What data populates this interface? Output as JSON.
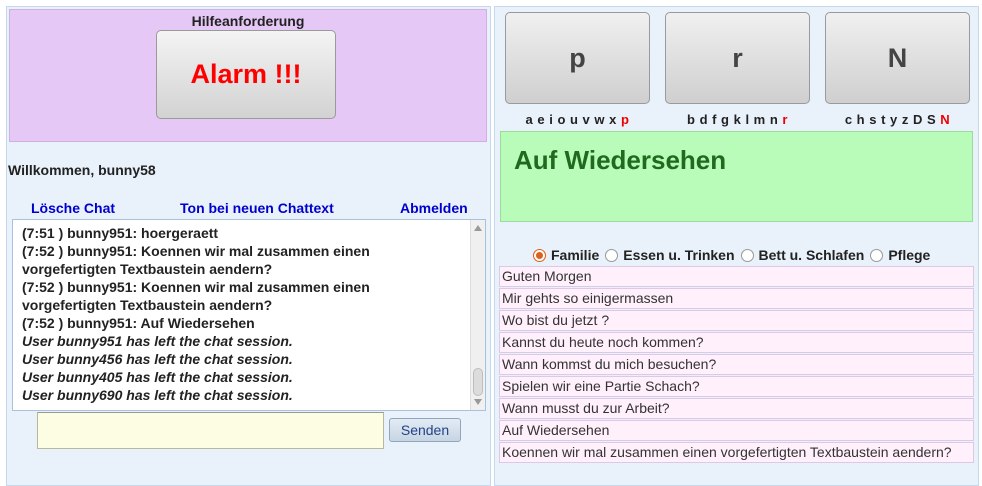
{
  "help": {
    "title": "Hilfeanforderung",
    "alarm_label": "Alarm !!!"
  },
  "welcome": "Willkommen, bunny58",
  "links": {
    "clear_chat": "Lösche Chat",
    "sound": "Ton bei neuen Chattext",
    "logout": "Abmelden"
  },
  "chat": {
    "lines": [
      {
        "text": "(7:51 ) bunny951: hoergeraett",
        "style": "normal"
      },
      {
        "text": "(7:52 ) bunny951: Koennen wir mal zusammen einen",
        "style": "normal"
      },
      {
        "text": "vorgefertigten Textbaustein aendern?",
        "style": "normal"
      },
      {
        "text": "(7:52 ) bunny951: Koennen wir mal zusammen einen",
        "style": "normal"
      },
      {
        "text": "vorgefertigten Textbaustein aendern?",
        "style": "normal"
      },
      {
        "text": "(7:52 ) bunny951: Auf Wiedersehen",
        "style": "normal"
      },
      {
        "text": "User bunny951 has left the chat session.",
        "style": "italic"
      },
      {
        "text": "User bunny456 has left the chat session.",
        "style": "italic"
      },
      {
        "text": "User bunny405 has left the chat session.",
        "style": "italic"
      },
      {
        "text": "User bunny690 has left the chat session.",
        "style": "italic"
      }
    ],
    "input_value": "",
    "send_label": "Senden"
  },
  "letters": [
    {
      "label": "p",
      "chars": "a e i o u v w x",
      "highlight": "p"
    },
    {
      "label": "r",
      "chars": "b d f g k l m n",
      "highlight": "r"
    },
    {
      "label": "N",
      "chars": "c h s t y z D S",
      "highlight": "N"
    }
  ],
  "display_phrase": "Auf Wiedersehen",
  "categories": [
    {
      "label": "Familie",
      "checked": true
    },
    {
      "label": "Essen u. Trinken",
      "checked": false
    },
    {
      "label": "Bett u. Schlafen",
      "checked": false
    },
    {
      "label": "Pflege",
      "checked": false
    }
  ],
  "phrases": [
    "Guten Morgen",
    "Mir gehts so einigermassen",
    "Wo bist du jetzt ?",
    "Kannst du heute noch kommen?",
    "Wann kommst du mich besuchen?",
    "Spielen wir eine Partie Schach?",
    "Wann musst du zur Arbeit?",
    "Auf Wiedersehen",
    "Koennen wir mal zusammen einen vorgefertigten Textbaustein aendern?"
  ]
}
